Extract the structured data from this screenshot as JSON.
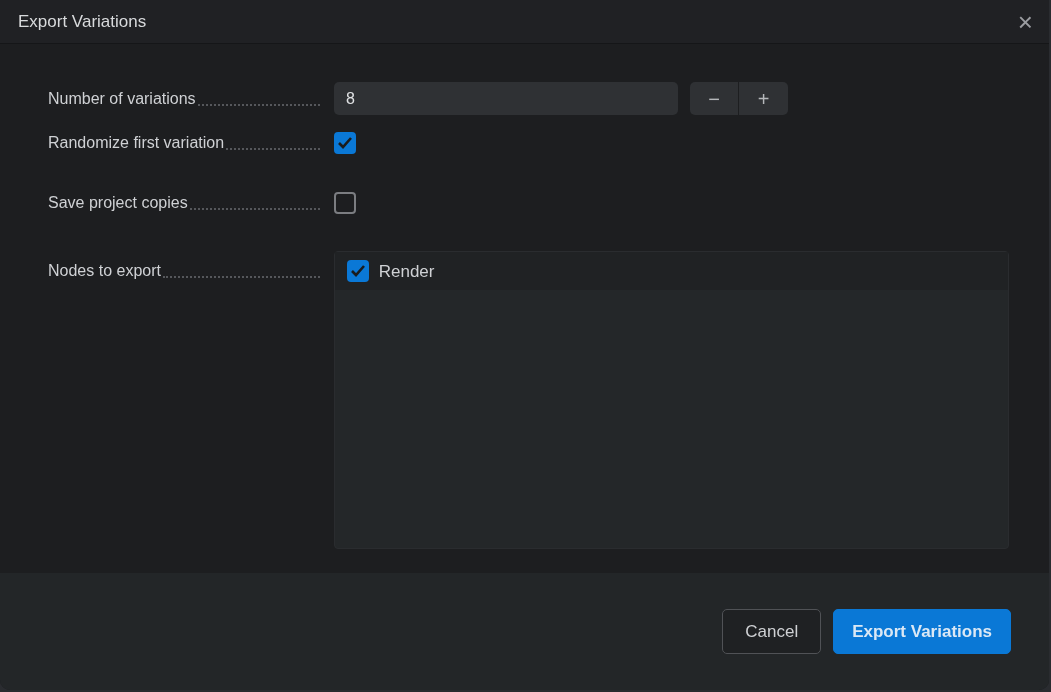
{
  "window": {
    "title": "Export Variations",
    "close": "×"
  },
  "fields": [
    {
      "kind": "number",
      "label": "Number of variations",
      "value": "8",
      "decrement": "−",
      "increment": "+"
    },
    {
      "kind": "checkbox",
      "label": "Randomize first variation",
      "checked": true
    },
    {
      "kind": "checkbox",
      "label": "Save project copies",
      "checked": false
    },
    {
      "kind": "list",
      "label": "Nodes to export",
      "items": [
        {
          "label": "Render",
          "checked": true
        }
      ]
    }
  ],
  "buttons": [
    {
      "label": "Cancel",
      "kind": "secondary"
    },
    {
      "label": "Export Variations",
      "kind": "primary"
    }
  ]
}
